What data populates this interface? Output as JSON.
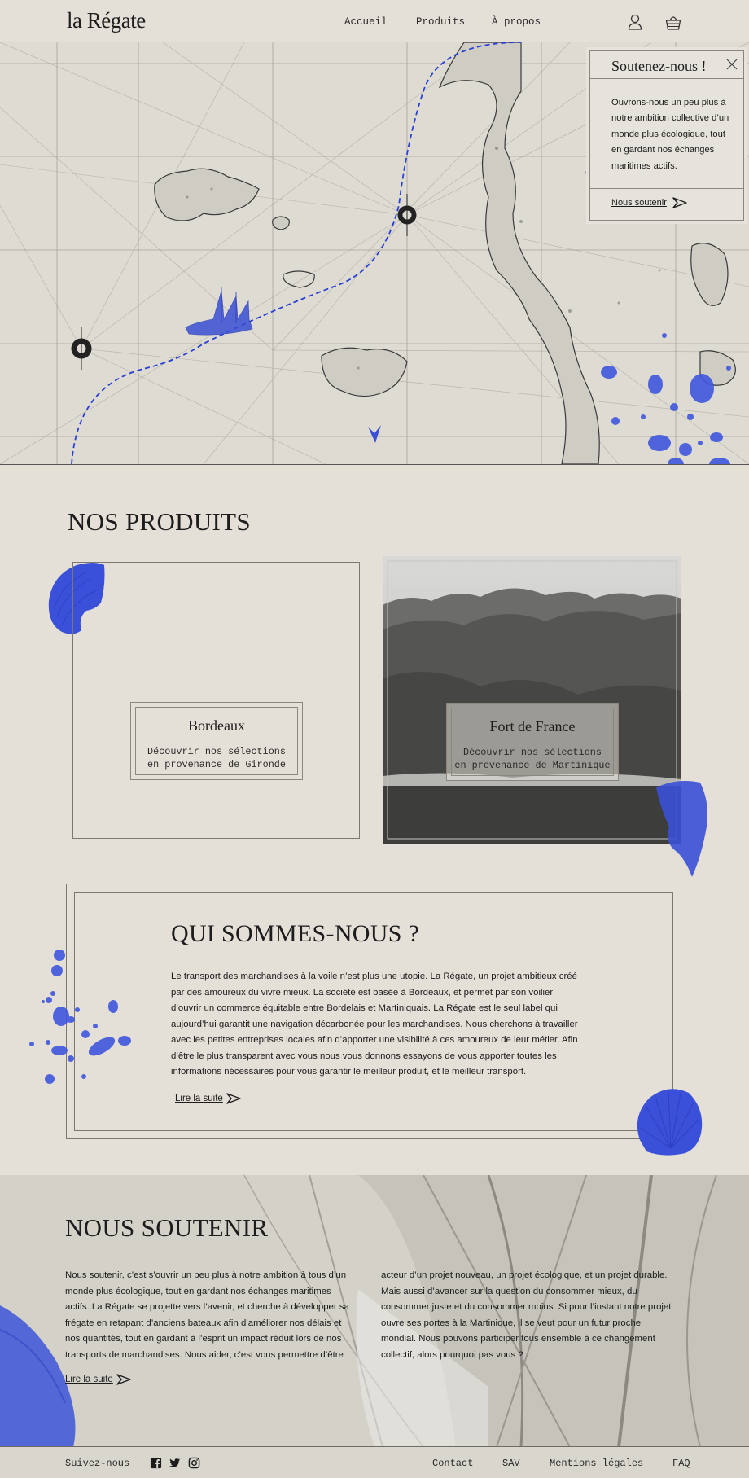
{
  "header": {
    "logo": "la Régate",
    "nav": [
      "Accueil",
      "Produits",
      "À propos"
    ],
    "account_icon": "user-icon",
    "cart_icon": "basket-icon"
  },
  "popup": {
    "title": "Soutenez-nous !",
    "body": "Ouvrons-nous un peu plus à notre ambition collective d’un monde plus écologique, tout en gardant nos échanges maritimes actifs.",
    "link": "Nous soutenir",
    "close_icon": "close-icon"
  },
  "products": {
    "title": "NOS PRODUITS",
    "items": [
      {
        "name": "Bordeaux",
        "sub1": "Découvrir nos sélections",
        "sub2": "en provenance de Gironde"
      },
      {
        "name": "Fort de France",
        "sub1": "Découvrir nos sélections",
        "sub2": "en provenance de Martinique"
      }
    ]
  },
  "about": {
    "title": "QUI SOMMES-NOUS ?",
    "body": "Le transport des marchandises à la voile n’est plus une utopie. La Régate, un projet ambitieux créé par des amoureux du vivre mieux. La société est basée à Bordeaux, et permet par son voilier d’ouvrir un commerce équitable entre Bordelais et Martiniquais. La Régate est le seul label qui aujourd’hui garantit une navigation décarbonée pour les marchandises. Nous cherchons à travailler avec les petites entreprises locales afin d’apporter une visibilité à ces amoureux de leur métier. Afin d’être le plus transparent avec vous nous vous donnons essayons de vous apporter toutes les informations nécessaires pour vous garantir le meilleur produit, et le meilleur transport.",
    "link": "Lire la suite"
  },
  "support": {
    "title": "NOUS SOUTENIR",
    "col1": "Nous soutenir, c’est s’ouvrir un peu plus à notre ambition à tous d’un monde plus écologique, tout en gardant nos échanges maritimes actifs. La Régate se projette vers l’avenir, et cherche à développer sa frégate en retapant d’anciens bateaux afin d’améliorer nos délais et nos quantités, tout en gardant à l’esprit un impact réduit lors de nos transports de marchandises. Nous aider, c’est vous permettre d’être",
    "col2": "acteur d’un projet nouveau, un projet écologique, et un projet durable. Mais aussi d’avancer sur la question du consommer mieux, du consommer juste et du consommer moins. Si pour l’instant notre projet ouvre ses portes à la Martinique, il se veut pour un futur proche mondial. Nous pouvons participer tous ensemble à ce changement collectif,  alors pourquoi pas vous ?",
    "link": "Lire la suite"
  },
  "footer": {
    "follow": "Suivez-nous",
    "social_icons": [
      "facebook-icon",
      "twitter-icon",
      "instagram-icon"
    ],
    "links": [
      "Contact",
      "SAV",
      "Mentions légales",
      "FAQ"
    ]
  },
  "colors": {
    "background": "#e4e0d8",
    "accent_blue": "#3a4fd4",
    "text": "#1c1c1c"
  }
}
